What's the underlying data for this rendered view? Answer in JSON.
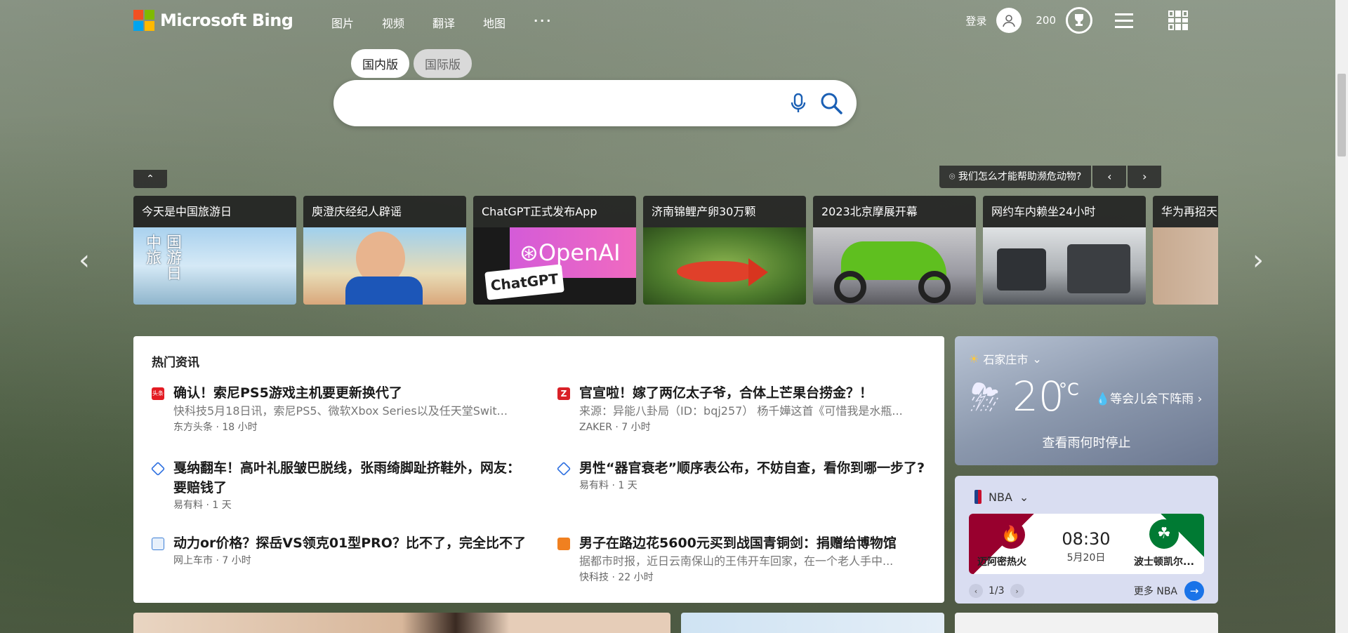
{
  "brand": {
    "name": "Microsoft Bing",
    "colors": [
      "#f25022",
      "#7fba00",
      "#00a4ef",
      "#ffb900"
    ]
  },
  "topnav": [
    "图片",
    "视频",
    "翻译",
    "地图",
    "···"
  ],
  "account": {
    "login_label": "登录",
    "points": "200"
  },
  "search": {
    "scopes": [
      "国内版",
      "国际版"
    ],
    "active_scope": "国内版",
    "value": "",
    "placeholder": ""
  },
  "carousel": {
    "top_right_text": "我们怎么才能帮助濒危动物?",
    "cards": [
      {
        "title": "今天是中国旅游日",
        "image": "travel-day"
      },
      {
        "title": "庾澄庆经纪人辟谣",
        "image": "singer"
      },
      {
        "title": "ChatGPT正式发布App",
        "image": "openai"
      },
      {
        "title": "济南锦鲤产卵30万颗",
        "image": "fish"
      },
      {
        "title": "2023北京摩展开幕",
        "image": "motorcycle"
      },
      {
        "title": "网约车内赖坐24小时",
        "image": "car"
      },
      {
        "title": "华为再招天",
        "image": "huawei"
      }
    ]
  },
  "news": {
    "heading": "热门资讯",
    "items": [
      {
        "title": "确认！索尼PS5游戏主机要更新换代了",
        "snippet": "快科技5月18日讯，索尼PS5、微软Xbox Series以及任天堂Swit...",
        "meta": "东方头条 · 18 小时",
        "icon_color": "#e31b23"
      },
      {
        "title": "官宣啦！嫁了两亿太子爷，合体上芒果台捞金？！",
        "snippet": "来源：异能八卦局（ID：bqj257） 杨千嬅这首《可惜我是水瓶...",
        "meta": "ZAKER · 7 小时",
        "icon_color": "#d92128"
      },
      {
        "title": "戛纳翻车！高叶礼服皱巴脱线，张雨绮脚趾挤鞋外，网友：要赔钱了",
        "snippet": "",
        "meta": "易有料 · 1 天",
        "icon_color": "#2b6ee0"
      },
      {
        "title": "男性“器官衰老”顺序表公布，不妨自查，看你到哪一步了?",
        "snippet": "",
        "meta": "易有料 · 1 天",
        "icon_color": "#2b6ee0"
      },
      {
        "title": "动力or价格？探岳VS领克01型PRO？比不了，完全比不了",
        "snippet": "",
        "meta": "网上车市 · 7 小时",
        "icon_color": "#3d7fd6"
      },
      {
        "title": "男子在路边花5600元买到战国青铜剑：捐赠给博物馆",
        "snippet": "据都市时报，近日云南保山的王伟开车回家，在一个老人手中...",
        "meta": "快科技 · 22 小时",
        "icon_color": "#f08020"
      }
    ]
  },
  "weather": {
    "city": "石家庄市",
    "temp": "20",
    "unit": "°C",
    "condition": "等会儿会下阵雨",
    "link": "查看雨何时停止"
  },
  "nba": {
    "label": "NBA",
    "home": "迈阿密热火",
    "away": "波士顿凯尔...",
    "time": "08:30",
    "date": "5月20日",
    "pager": "1/3",
    "more": "更多 NBA"
  }
}
